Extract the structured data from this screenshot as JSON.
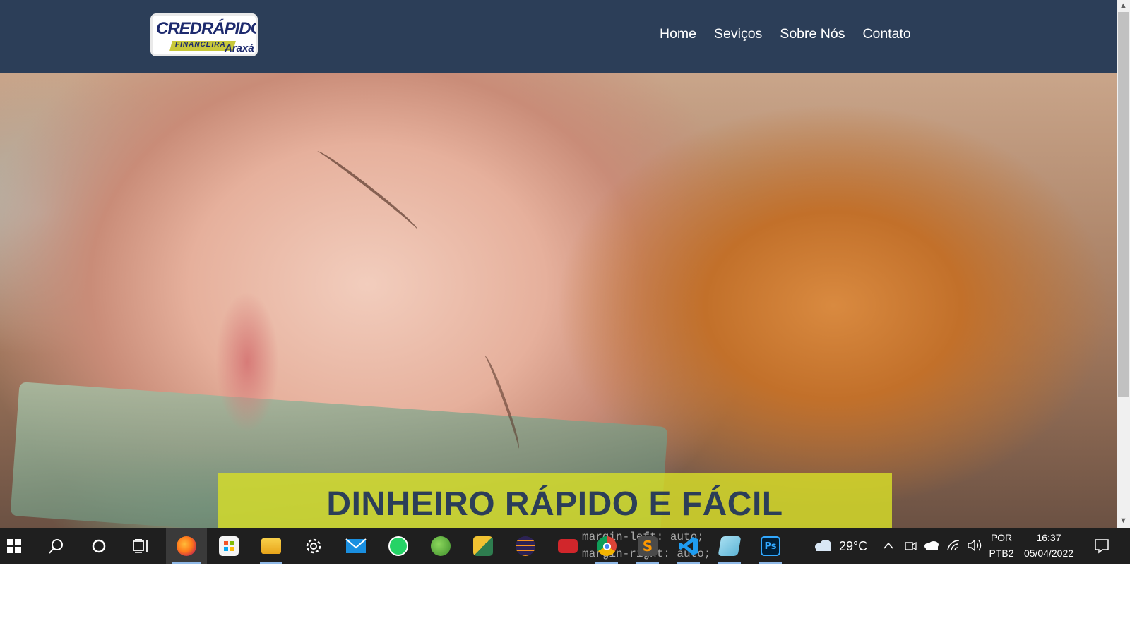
{
  "site": {
    "logo": {
      "line1": "CREDRÁPIDO",
      "line2": "FINANCEIRA",
      "line3": "Araxá"
    },
    "nav": [
      "Home",
      "Seviços",
      "Sobre Nós",
      "Contato"
    ]
  },
  "hero": {
    "title": "DINHEIRO RÁPIDO E FÁCIL",
    "image": "woman-sleeping-on-money-photo"
  },
  "scrollbar": {
    "up_icon": "▲",
    "down_icon": "▼"
  },
  "taskbar": {
    "apps": [
      {
        "name": "start",
        "icon": "windows-logo-icon"
      },
      {
        "name": "search",
        "icon": "search-icon"
      },
      {
        "name": "cortana",
        "icon": "circle-icon"
      },
      {
        "name": "task-view",
        "icon": "task-view-icon"
      },
      {
        "name": "firefox",
        "icon": "firefox-icon",
        "active": true
      },
      {
        "name": "microsoft-store",
        "icon": "store-icon"
      },
      {
        "name": "file-explorer",
        "icon": "folder-icon"
      },
      {
        "name": "settings",
        "icon": "gear-icon"
      },
      {
        "name": "mail",
        "icon": "mail-icon"
      },
      {
        "name": "whatsapp",
        "icon": "whatsapp-icon"
      },
      {
        "name": "spring-tools",
        "icon": "leaf-icon"
      },
      {
        "name": "app-x",
        "icon": "app-icon"
      },
      {
        "name": "eclipse",
        "icon": "eclipse-icon"
      },
      {
        "name": "toolbox",
        "icon": "toolbox-icon"
      },
      {
        "name": "chrome",
        "icon": "chrome-icon"
      },
      {
        "name": "sublime-text",
        "icon": "sublime-icon",
        "label": "S"
      },
      {
        "name": "vscode",
        "icon": "vscode-icon"
      },
      {
        "name": "notepad",
        "icon": "notepad-icon"
      },
      {
        "name": "photoshop",
        "icon": "photoshop-icon",
        "label": "Ps"
      }
    ],
    "code_overlay": [
      "margin-left: auto;",
      "margin-right: auto;"
    ],
    "tray": {
      "weather": "29°C",
      "language_top": "POR",
      "language_bottom": "PTB2",
      "time": "16:37",
      "date": "05/04/2022"
    }
  },
  "colors": {
    "header_bg": "#2c3e58",
    "banner_bg": "#d7de28",
    "title_color": "#2c3e58",
    "taskbar_bg": "#1f1f1f"
  }
}
